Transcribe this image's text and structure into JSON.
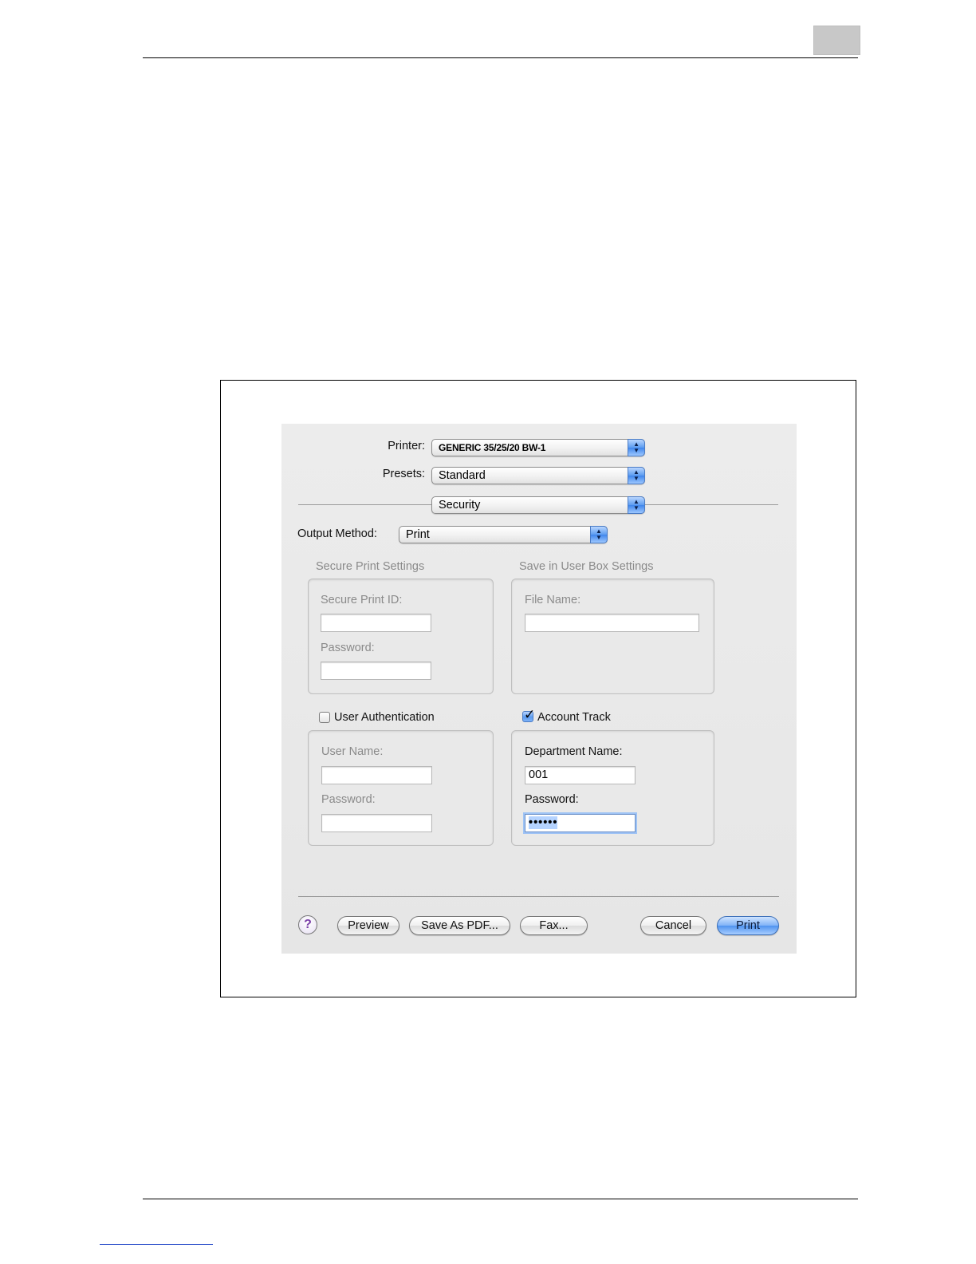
{
  "dialog": {
    "printer": {
      "label": "Printer:",
      "value": "GENERIC 35/25/20 BW-1"
    },
    "presets": {
      "label": "Presets:",
      "value": "Standard"
    },
    "panel": {
      "value": "Security"
    },
    "output_method": {
      "label": "Output Method:",
      "value": "Print"
    },
    "secure_print": {
      "title": "Secure Print Settings",
      "id_label": "Secure Print ID:",
      "id_value": "",
      "password_label": "Password:",
      "password_value": ""
    },
    "user_box": {
      "title": "Save in User Box Settings",
      "file_name_label": "File Name:",
      "file_name_value": ""
    },
    "user_auth": {
      "label": "User Authentication",
      "checked": false,
      "user_name_label": "User Name:",
      "user_name_value": "",
      "password_label": "Password:",
      "password_value": ""
    },
    "account_track": {
      "label": "Account Track",
      "checked": true,
      "department_label": "Department Name:",
      "department_value": "001",
      "password_label": "Password:",
      "password_value": "••••••"
    },
    "buttons": {
      "help": "?",
      "preview": "Preview",
      "save_pdf": "Save As PDF...",
      "fax": "Fax...",
      "cancel": "Cancel",
      "print": "Print"
    }
  },
  "colors": {
    "accent": "#5b9bf0",
    "disabled_text": "#8a8a8a",
    "dialog_bg": "#e9e9e9"
  }
}
